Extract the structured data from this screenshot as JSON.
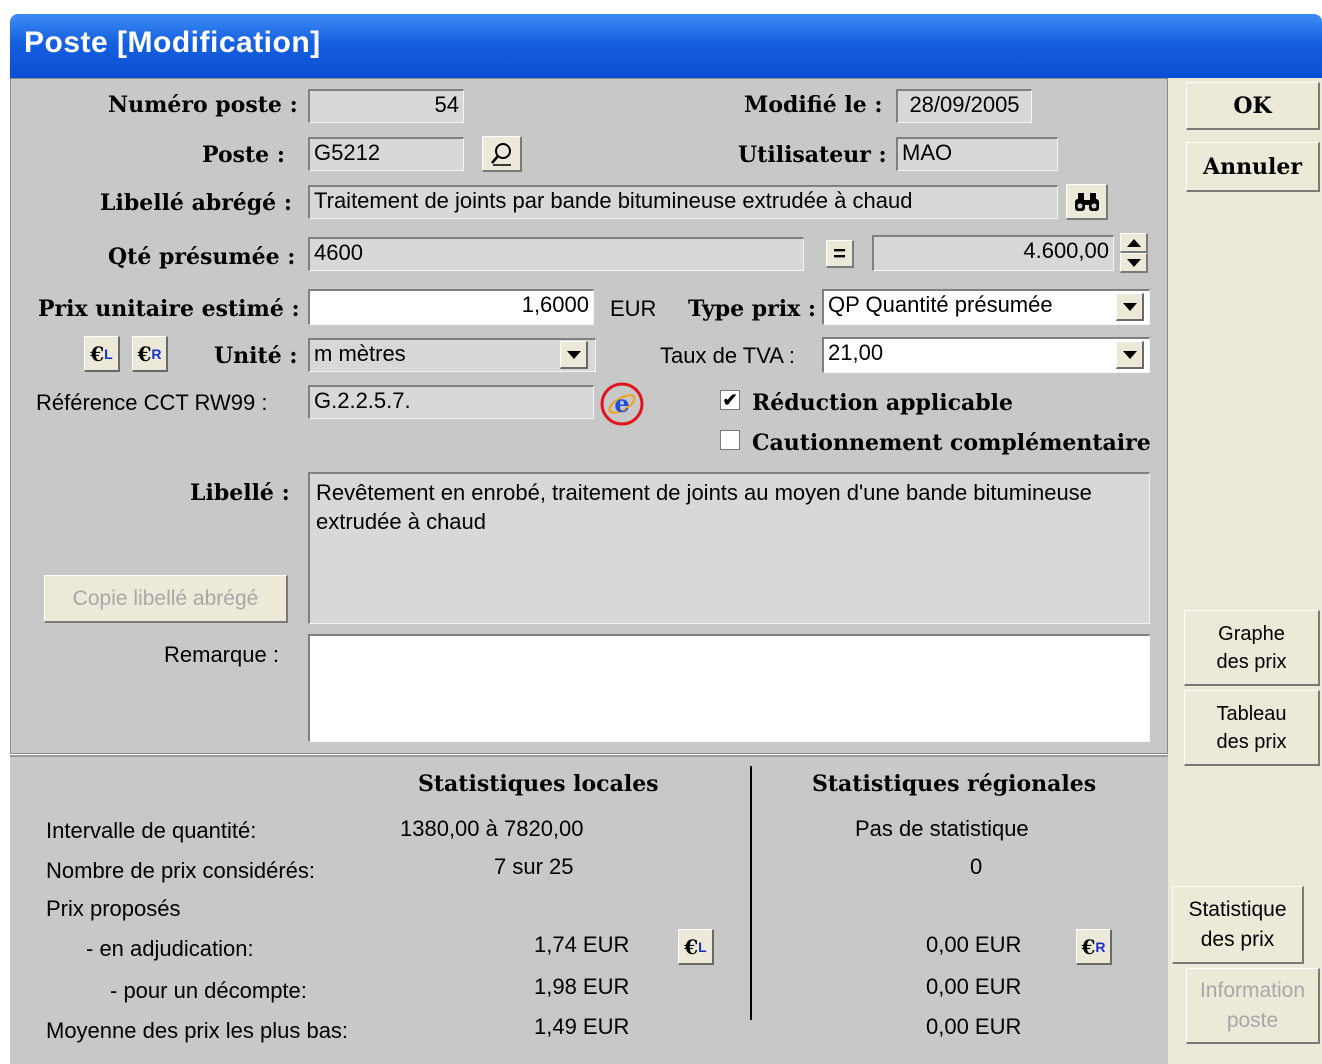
{
  "window": {
    "title": "Poste [Modification]"
  },
  "form": {
    "numero_label": "Numéro poste :",
    "numero_value": "54",
    "modifie_label": "Modifié le :",
    "modifie_value": "28/09/2005",
    "poste_label": "Poste  :",
    "poste_value": "G5212",
    "utilisateur_label": "Utilisateur :",
    "utilisateur_value": "MAO",
    "libelle_abrege_label": "Libellé abrégé :",
    "libelle_abrege_value": "Traitement de joints par bande bitumineuse extrudée à chaud",
    "qte_label": "Qté présumée :",
    "qte_value": "4600",
    "qte_equals": "=",
    "qte_computed": "4.600,00",
    "prix_label": "Prix unitaire estimé :",
    "prix_value": "1,6000",
    "prix_currency": "EUR",
    "type_prix_label": "Type prix :",
    "type_prix_value": "QP Quantité présumée",
    "euro_l": "€",
    "euro_l_sub": "L",
    "euro_r": "€",
    "euro_r_sub": "R",
    "unite_label": "Unité :",
    "unite_value": "m mètres",
    "tva_label": "Taux de TVA :",
    "tva_value": "21,00",
    "ref_label": "Référence CCT RW99 :",
    "ref_value": "G.2.2.5.7.",
    "reduction_label": "Réduction applicable",
    "reduction_checked": true,
    "caution_label": "Cautionnement complémentaire",
    "caution_checked": false,
    "libelle_label": "Libellé :",
    "libelle_value": "Revêtement en enrobé, traitement de joints au moyen d'une bande bitumineuse extrudée à chaud",
    "copie_button": "Copie libellé abrégé",
    "remarque_label": "Remarque :",
    "remarque_value": ""
  },
  "stats": {
    "locales_header": "Statistiques locales",
    "regionales_header": "Statistiques régionales",
    "intervalle_label": "Intervalle de quantité:",
    "intervalle_local": "1380,00  à  7820,00",
    "intervalle_regional": "Pas de statistique",
    "nombre_label": "Nombre de prix considérés:",
    "nombre_local": "7  sur  25",
    "nombre_regional": "0",
    "prix_proposes_label": "Prix proposés",
    "adjudication_label": "- en adjudication:",
    "adjudication_local": "1,74  EUR",
    "adjudication_regional": "0,00  EUR",
    "decompte_label": "- pour un décompte:",
    "decompte_local": "1,98  EUR",
    "decompte_regional": "0,00  EUR",
    "moyenne_label": "Moyenne des prix les plus bas:",
    "moyenne_local": "1,49  EUR",
    "moyenne_regional": "0,00  EUR"
  },
  "sidebar": {
    "ok": "OK",
    "annuler": "Annuler",
    "graphe_1": "Graphe",
    "graphe_2": "des prix",
    "tableau_1": "Tableau",
    "tableau_2": "des prix",
    "statistique_1": "Statistique",
    "statistique_2": "des prix",
    "information_1": "Information",
    "information_2": "poste"
  }
}
